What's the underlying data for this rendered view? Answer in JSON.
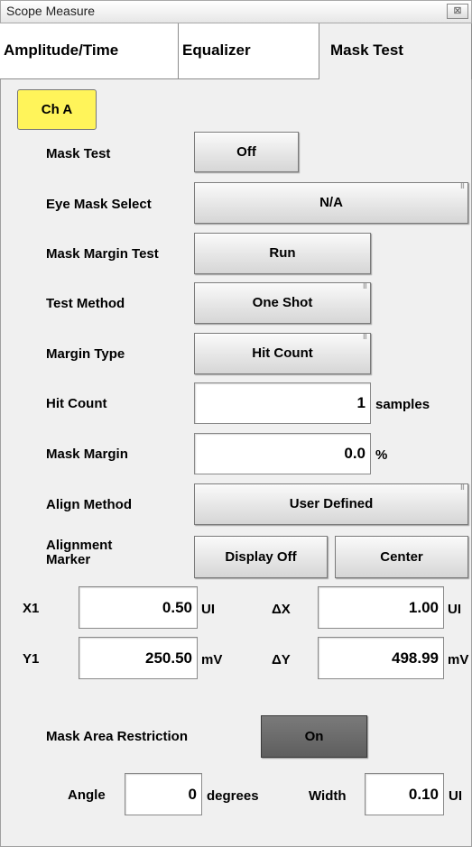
{
  "window": {
    "title": "Scope Measure",
    "close_label": "⊠"
  },
  "tabs": [
    "Amplitude/Time",
    "Equalizer",
    "Mask Test"
  ],
  "channel_button": "Ch A",
  "rows": {
    "mask_test": {
      "label": "Mask Test",
      "value": "Off"
    },
    "eye_mask_select": {
      "label": "Eye Mask Select",
      "value": "N/A"
    },
    "mask_margin_test": {
      "label": "Mask Margin Test",
      "value": "Run"
    },
    "test_method": {
      "label": "Test Method",
      "value": "One Shot"
    },
    "margin_type": {
      "label": "Margin Type",
      "value": "Hit Count"
    },
    "hit_count": {
      "label": "Hit Count",
      "value": "1",
      "unit": "samples"
    },
    "mask_margin": {
      "label": "Mask Margin",
      "value": "0.0",
      "unit": "%"
    },
    "align_method": {
      "label": "Align Method",
      "value": "User Defined"
    },
    "alignment_marker": {
      "label_line1": "Alignment",
      "label_line2": "Marker",
      "display_button": "Display Off",
      "center_button": "Center"
    }
  },
  "coords": {
    "x1": {
      "label": "X1",
      "value": "0.50",
      "unit": "UI"
    },
    "dx": {
      "label": "ΔX",
      "value": "1.00",
      "unit": "UI"
    },
    "y1": {
      "label": "Y1",
      "value": "250.50",
      "unit": "mV"
    },
    "dy": {
      "label": "ΔY",
      "value": "498.99",
      "unit": "mV"
    }
  },
  "mask_area_restriction": {
    "label": "Mask Area Restriction",
    "value": "On"
  },
  "angle": {
    "label": "Angle",
    "value": "0",
    "unit": "degrees"
  },
  "width": {
    "label": "Width",
    "value": "0.10",
    "unit": "UI"
  }
}
